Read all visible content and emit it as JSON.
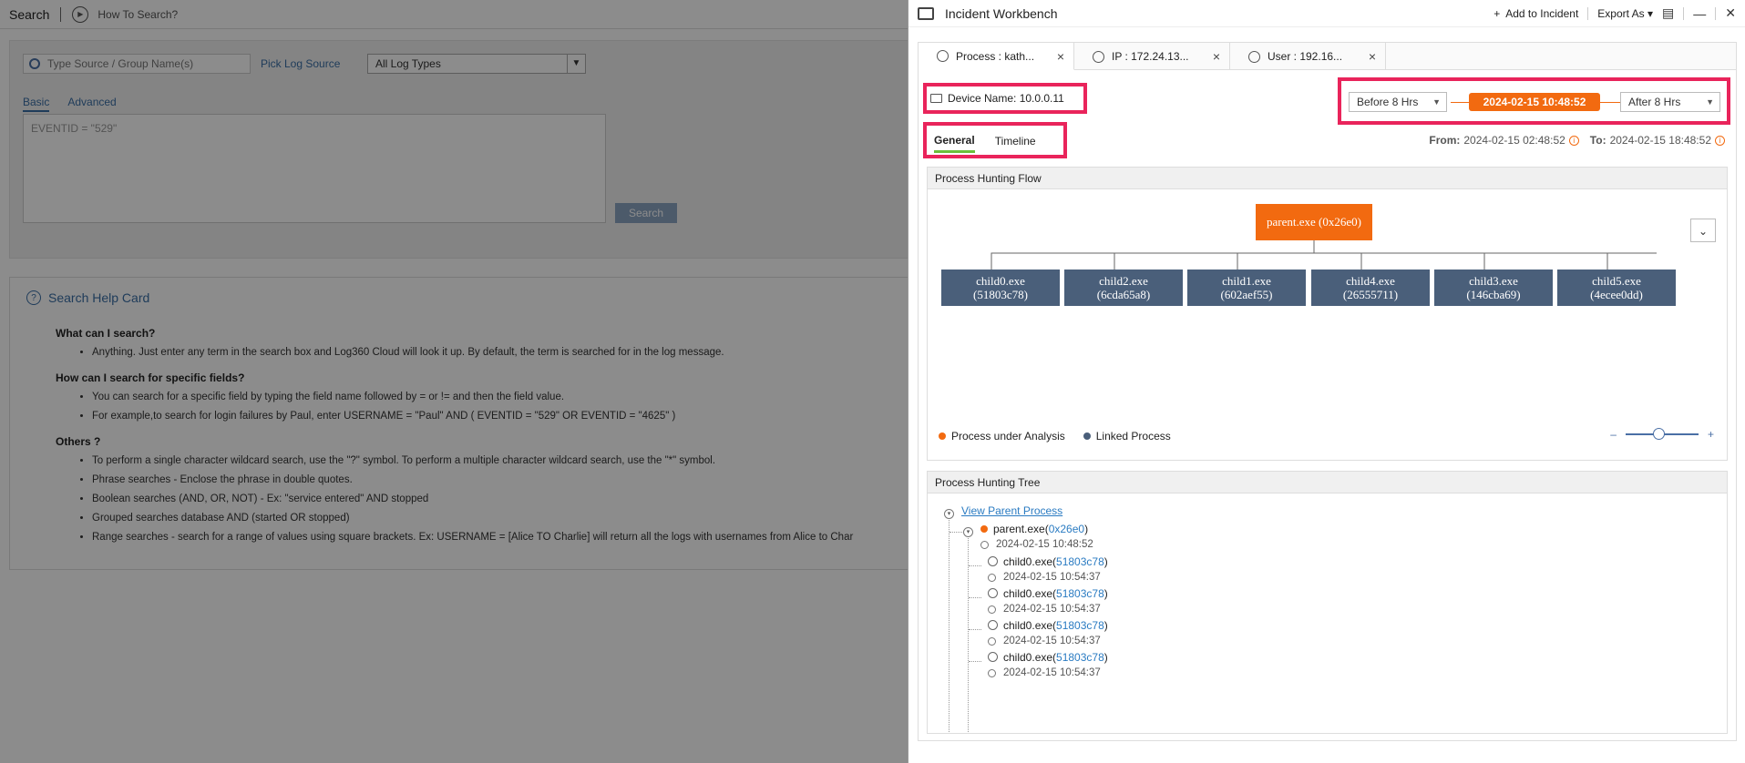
{
  "background": {
    "title": "Search",
    "how_to": "How To Search?",
    "source_placeholder": "Type Source / Group Name(s)",
    "pick_log_source": "Pick Log Source",
    "log_type": "All Log Types",
    "tabs": [
      "Basic",
      "Advanced"
    ],
    "query_placeholder": "EVENTID = \"529\"",
    "search_button": "Search",
    "help_card": {
      "title": "Search Help Card",
      "sections": [
        {
          "heading": "What can I search?",
          "items": [
            "Anything. Just enter any term in the search box and Log360 Cloud will look it up. By default, the term is searched for in the log message."
          ]
        },
        {
          "heading": "How can I search for specific fields?",
          "items": [
            "You can search for a specific field by typing the field name followed by = or != and then the field value.",
            "For example,to search for login failures by Paul, enter USERNAME = \"Paul\" AND ( EVENTID = \"529\" OR EVENTID = \"4625\" )"
          ]
        },
        {
          "heading": "Others ?",
          "items": [
            "To perform a single character wildcard search, use the \"?\" symbol. To perform a multiple character wildcard search, use the \"*\" symbol.",
            "Phrase searches - Enclose the phrase in double quotes.",
            "Boolean searches (AND, OR, NOT) - Ex: \"service entered\" AND stopped",
            "Grouped searches database AND (started OR stopped)",
            "Range searches - search for a range of values using square brackets. Ex: USERNAME = [Alice TO Charlie] will return all the logs with usernames from Alice to Char"
          ]
        }
      ]
    }
  },
  "workbench": {
    "title": "Incident Workbench",
    "add_to_incident": "Add to Incident",
    "export_as": "Export As",
    "tabs": [
      {
        "label": "Process : kath...",
        "icon": "process-icon"
      },
      {
        "label": "IP : 172.24.13...",
        "icon": "globe-icon"
      },
      {
        "label": "User : 192.16...",
        "icon": "user-icon"
      }
    ],
    "device_label": "Device Name: 10.0.0.11",
    "before": "Before 8 Hrs",
    "center_time": "2024-02-15 10:48:52",
    "after": "After 8 Hrs",
    "subtabs": [
      "General",
      "Timeline"
    ],
    "from_label": "From:",
    "from_value": "2024-02-15 02:48:52",
    "to_label": "To:",
    "to_value": "2024-02-15 18:48:52",
    "flow": {
      "title": "Process Hunting Flow",
      "parent": "parent.exe (0x26e0)",
      "children": [
        {
          "name": "child0.exe",
          "id": "(51803c78)"
        },
        {
          "name": "child2.exe",
          "id": "(6cda65a8)"
        },
        {
          "name": "child1.exe",
          "id": "(602aef55)"
        },
        {
          "name": "child4.exe",
          "id": "(26555711)"
        },
        {
          "name": "child3.exe",
          "id": "(146cba69)"
        },
        {
          "name": "child5.exe",
          "id": "(4ecee0dd)"
        }
      ],
      "legend": [
        "Process under Analysis",
        "Linked Process"
      ],
      "legend_colors": [
        "#f26a10",
        "#4a5f7a"
      ],
      "zoom_level": 0.45
    },
    "tree": {
      "title": "Process Hunting Tree",
      "view_parent": "View Parent Process",
      "parent_name": "parent.exe(",
      "parent_pid": "0x26e0",
      "parent_close": ")",
      "parent_time": "2024-02-15 10:48:52",
      "children": [
        {
          "name": "child0.exe(",
          "pid": "51803c78",
          "close": ")",
          "time": "2024-02-15 10:54:37"
        },
        {
          "name": "child0.exe(",
          "pid": "51803c78",
          "close": ")",
          "time": "2024-02-15 10:54:37"
        },
        {
          "name": "child0.exe(",
          "pid": "51803c78",
          "close": ")",
          "time": "2024-02-15 10:54:37"
        },
        {
          "name": "child0.exe(",
          "pid": "51803c78",
          "close": ")",
          "time": "2024-02-15 10:54:37"
        }
      ]
    }
  }
}
